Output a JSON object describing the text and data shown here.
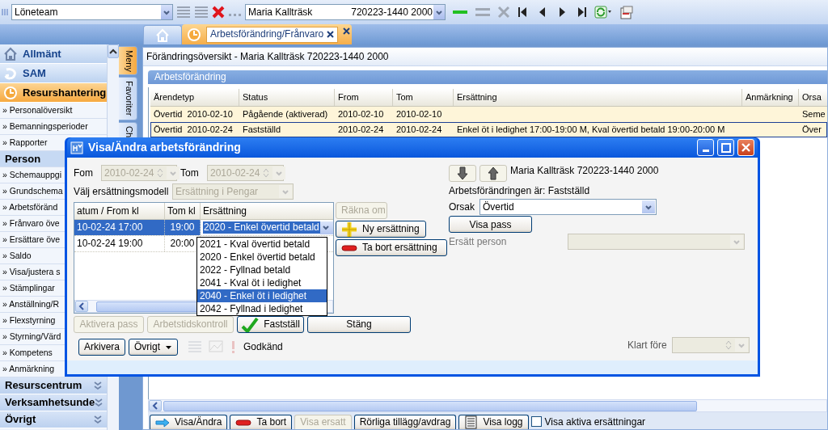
{
  "toolbar": {
    "unit_field": "Löneteam",
    "person_name": "Maria Kallträsk",
    "person_id": "720223-1440 2000"
  },
  "tabs": [
    {
      "kind": "home",
      "selected": false
    },
    {
      "kind": "page",
      "label": "Arbetsförändring/Frånvaro",
      "selected": true
    }
  ],
  "sidebar": [
    {
      "kind": "module",
      "label": "Allmänt",
      "selected": false
    },
    {
      "kind": "module",
      "label": "SAM",
      "selected": false
    },
    {
      "kind": "module",
      "label": "Resurshantering",
      "selected": true
    },
    {
      "kind": "link",
      "label": "» Personalöversikt"
    },
    {
      "kind": "link",
      "label": "» Bemanningsperioder"
    },
    {
      "kind": "link",
      "label": "» Rapporter"
    },
    {
      "kind": "header",
      "label": "Person"
    },
    {
      "kind": "link",
      "label": "» Schemauppgi"
    },
    {
      "kind": "link",
      "label": "» Grundschema"
    },
    {
      "kind": "link",
      "label": "» Arbetsföränd"
    },
    {
      "kind": "link",
      "label": "» Frånvaro öve"
    },
    {
      "kind": "link",
      "label": "» Ersättare öve"
    },
    {
      "kind": "link",
      "label": "» Saldo"
    },
    {
      "kind": "link",
      "label": "» Visa/justera s"
    },
    {
      "kind": "link",
      "label": "» Stämplingar"
    },
    {
      "kind": "link",
      "label": "» Anställning/R"
    },
    {
      "kind": "link",
      "label": "» Flexstyrning"
    },
    {
      "kind": "link",
      "label": "» Styrning/Värd"
    },
    {
      "kind": "link",
      "label": "» Kompetens"
    },
    {
      "kind": "link",
      "label": "» Anmärkning"
    },
    {
      "kind": "group",
      "label": "Resurscentrum",
      "expanded": false
    },
    {
      "kind": "group",
      "label": "Verksamhetsunde",
      "expanded": false
    },
    {
      "kind": "group",
      "label": "Övrigt",
      "expanded": false
    }
  ],
  "side_tabs": [
    {
      "label": "Meny",
      "selected": true
    },
    {
      "label": "Favoriter",
      "selected": false
    },
    {
      "label": "Ch",
      "selected": false
    }
  ],
  "panel": {
    "title": "Förändringsöversikt - Maria Kallträsk 720223-1440 2000",
    "section": "Arbetsförändring",
    "table": {
      "columns": [
        "Ärendetyp",
        "Status",
        "From",
        "Tom",
        "Ersättning",
        "Anmärkning",
        "Orsa"
      ],
      "rows": [
        {
          "cells": [
            "Övertid  2010-02-10",
            "Pågående (aktiverad)",
            "2010-02-10",
            "2010-02-10",
            "",
            "",
            "Seme"
          ],
          "selected": false
        },
        {
          "cells": [
            "Övertid  2010-02-24",
            "Fastställd",
            "2010-02-24",
            "2010-02-24",
            "Enkel öt i ledighet 17:00-19:00 M, Kval övertid betald 19:00-20:00 M",
            "",
            "Över"
          ],
          "selected": true
        }
      ]
    }
  },
  "bottom_buttons": [
    {
      "label": "Visa/Ändra",
      "kind": "show",
      "disabled": false
    },
    {
      "label": "Ta bort",
      "kind": "remove",
      "disabled": false
    },
    {
      "label": "Visa ersatt",
      "kind": "plain",
      "disabled": true
    },
    {
      "label": "Rörliga tillägg/avdrag",
      "kind": "plain",
      "disabled": false
    },
    {
      "label": "Visa logg",
      "kind": "log",
      "disabled": false
    }
  ],
  "active_filter": {
    "label": "Visa aktiva ersättningar",
    "checked": false
  },
  "dialog": {
    "title": "Visa/Ändra arbetsförändring",
    "from": {
      "label": "Fom",
      "value": "2010-02-24",
      "disabled": true
    },
    "to": {
      "label": "Tom",
      "value": "2010-02-24",
      "disabled": true
    },
    "model": {
      "label": "Välj ersättningsmodell",
      "value": "Ersättning i Pengar",
      "disabled": true
    },
    "grid": {
      "columns": [
        "atum / From kl",
        "Tom kl",
        "Ersättning"
      ],
      "rows": [
        {
          "from": "10-02-24 17:00",
          "to": "19:00",
          "compensation": "2020 - Enkel övertid betald",
          "selected": true
        },
        {
          "from": "10-02-24 19:00",
          "to": "20:00",
          "selected": false
        }
      ]
    },
    "dropdown": [
      {
        "label": "2021 - Kval övertid betald",
        "selected": false
      },
      {
        "label": "2020 - Enkel övertid betald",
        "selected": false
      },
      {
        "label": "2022 - Fyllnad betald",
        "selected": false
      },
      {
        "label": "2041 - Kval öt i ledighet",
        "selected": false
      },
      {
        "label": "2040 - Enkel öt i ledighet",
        "selected": true
      },
      {
        "label": "2042 - Fyllnad i ledighet",
        "selected": false
      }
    ],
    "side_buttons": [
      {
        "label": "Räkna om",
        "kind": "plain",
        "disabled": true
      },
      {
        "label": "Ny ersättning",
        "kind": "add",
        "disabled": false
      },
      {
        "label": "Ta bort ersättning",
        "kind": "remove",
        "disabled": false
      }
    ],
    "action_buttons": [
      {
        "label": "Aktivera pass",
        "kind": "plain",
        "disabled": true
      },
      {
        "label": "Arbetstidskontroll",
        "kind": "plain",
        "disabled": true
      },
      {
        "label": "Fastställ",
        "kind": "confirm",
        "disabled": false
      },
      {
        "label": "Stäng",
        "kind": "wide",
        "disabled": false
      }
    ],
    "footer_buttons": [
      {
        "label": "Arkivera",
        "kind": "plain"
      },
      {
        "label": "Övrigt",
        "kind": "menu"
      }
    ],
    "approval": "Godkänd",
    "person": "Maria Kallträsk 720223-1440 2000",
    "status_text": "Arbetsförändringen är: Fastställd",
    "reason": {
      "label": "Orsak",
      "value": "Övertid",
      "disabled": false
    },
    "show_shifts": "Visa pass",
    "replace": {
      "label": "Ersätt person",
      "disabled": true
    },
    "done": {
      "label": "Klart före",
      "disabled": true
    }
  }
}
